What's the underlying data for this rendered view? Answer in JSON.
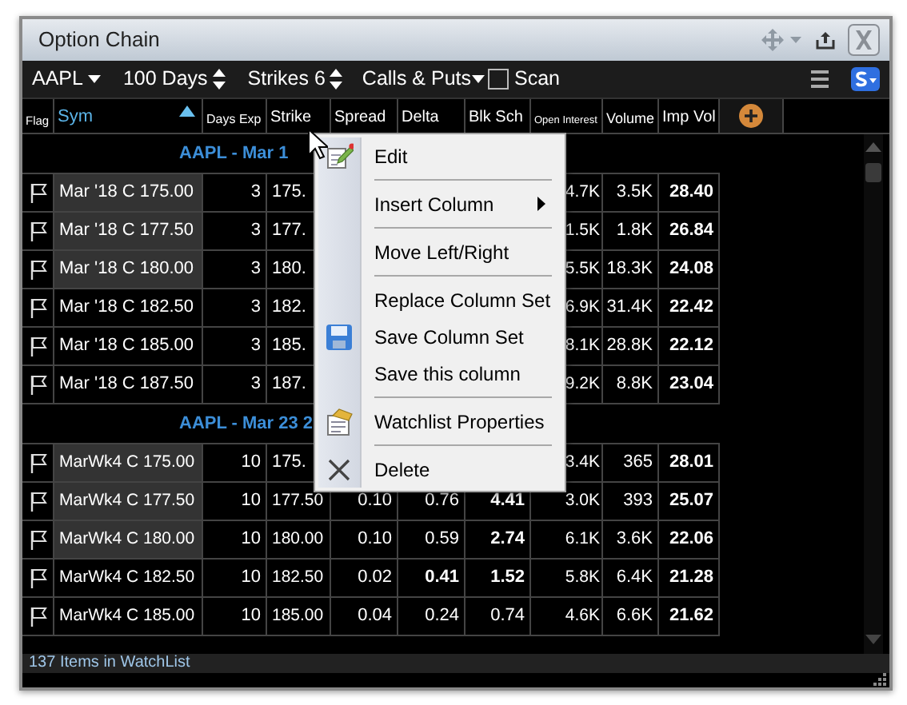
{
  "window": {
    "title": "Option Chain"
  },
  "toolbar": {
    "symbol": "AAPL",
    "days": "100 Days",
    "strikes": "Strikes 6",
    "option_type": "Calls & Puts",
    "scan": {
      "label": "Scan",
      "checked": false
    }
  },
  "columns": [
    {
      "label": "Flag",
      "sorted": false
    },
    {
      "label": "Sym",
      "sorted": true
    },
    {
      "label": "Days Exp",
      "sorted": false
    },
    {
      "label": "Strike",
      "sorted": false
    },
    {
      "label": "Spread",
      "sorted": false
    },
    {
      "label": "Delta",
      "sorted": false
    },
    {
      "label": "Blk Sch",
      "sorted": false
    },
    {
      "label": "Open Interest",
      "sorted": false
    },
    {
      "label": "Volume",
      "sorted": false
    },
    {
      "label": "Imp Vol",
      "sorted": false
    }
  ],
  "groups": [
    {
      "title": "AAPL - Mar 1",
      "rows": [
        {
          "highlighted": true,
          "cells": [
            {
              "text": "Mar '18 C 175.00",
              "bold": false
            },
            {
              "text": "3",
              "bold": false
            },
            {
              "text": "175.",
              "bold": false
            },
            null,
            null,
            null,
            {
              "text": "4.7K",
              "bold": false
            },
            {
              "text": "3.5K",
              "bold": false
            },
            {
              "text": "28.40",
              "bold": true
            }
          ]
        },
        {
          "highlighted": true,
          "cells": [
            {
              "text": "Mar '18 C 177.50",
              "bold": false
            },
            {
              "text": "3",
              "bold": false
            },
            {
              "text": "177.",
              "bold": false
            },
            null,
            null,
            null,
            {
              "text": "1.5K",
              "bold": false
            },
            {
              "text": "1.8K",
              "bold": false
            },
            {
              "text": "26.84",
              "bold": true
            }
          ]
        },
        {
          "highlighted": true,
          "cells": [
            {
              "text": "Mar '18 C 180.00",
              "bold": false
            },
            {
              "text": "3",
              "bold": false
            },
            {
              "text": "180.",
              "bold": false
            },
            null,
            null,
            null,
            {
              "text": "5.5K",
              "bold": false
            },
            {
              "text": "18.3K",
              "bold": false
            },
            {
              "text": "24.08",
              "bold": true
            }
          ]
        },
        {
          "highlighted": false,
          "cells": [
            {
              "text": "Mar '18 C 182.50",
              "bold": false
            },
            {
              "text": "3",
              "bold": false
            },
            {
              "text": "182.",
              "bold": false
            },
            null,
            null,
            null,
            {
              "text": "6.9K",
              "bold": false
            },
            {
              "text": "31.4K",
              "bold": false
            },
            {
              "text": "22.42",
              "bold": true
            }
          ]
        },
        {
          "highlighted": false,
          "cells": [
            {
              "text": "Mar '18 C 185.00",
              "bold": false
            },
            {
              "text": "3",
              "bold": false
            },
            {
              "text": "185.",
              "bold": false
            },
            null,
            null,
            null,
            {
              "text": "8.1K",
              "bold": false
            },
            {
              "text": "28.8K",
              "bold": false
            },
            {
              "text": "22.12",
              "bold": true
            }
          ]
        },
        {
          "highlighted": false,
          "cells": [
            {
              "text": "Mar '18 C 187.50",
              "bold": false
            },
            {
              "text": "3",
              "bold": false
            },
            {
              "text": "187.",
              "bold": false
            },
            null,
            null,
            null,
            {
              "text": "9.2K",
              "bold": false
            },
            {
              "text": "8.8K",
              "bold": false
            },
            {
              "text": "23.04",
              "bold": true
            }
          ]
        }
      ]
    },
    {
      "title": "AAPL - Mar 23 2",
      "rows": [
        {
          "highlighted": true,
          "cells": [
            {
              "text": "MarWk4 C 175.00",
              "bold": false
            },
            {
              "text": "10",
              "bold": false
            },
            {
              "text": "175.",
              "bold": false
            },
            null,
            null,
            null,
            {
              "text": "3.4K",
              "bold": false
            },
            {
              "text": "365",
              "bold": false
            },
            {
              "text": "28.01",
              "bold": true
            }
          ]
        },
        {
          "highlighted": true,
          "cells": [
            {
              "text": "MarWk4 C 177.50",
              "bold": false
            },
            {
              "text": "10",
              "bold": false
            },
            {
              "text": "177.50",
              "bold": false
            },
            {
              "text": "0.10",
              "bold": false
            },
            {
              "text": "0.76",
              "bold": false
            },
            {
              "text": "4.41",
              "bold": true
            },
            {
              "text": "3.0K",
              "bold": false
            },
            {
              "text": "393",
              "bold": false
            },
            {
              "text": "25.07",
              "bold": true
            }
          ]
        },
        {
          "highlighted": true,
          "cells": [
            {
              "text": "MarWk4 C 180.00",
              "bold": false
            },
            {
              "text": "10",
              "bold": false
            },
            {
              "text": "180.00",
              "bold": false
            },
            {
              "text": "0.10",
              "bold": false
            },
            {
              "text": "0.59",
              "bold": false
            },
            {
              "text": "2.74",
              "bold": true
            },
            {
              "text": "6.1K",
              "bold": false
            },
            {
              "text": "3.6K",
              "bold": false
            },
            {
              "text": "22.06",
              "bold": true
            }
          ]
        },
        {
          "highlighted": false,
          "cells": [
            {
              "text": "MarWk4 C 182.50",
              "bold": false
            },
            {
              "text": "10",
              "bold": false
            },
            {
              "text": "182.50",
              "bold": false
            },
            {
              "text": "0.02",
              "bold": false
            },
            {
              "text": "0.41",
              "bold": true
            },
            {
              "text": "1.52",
              "bold": true
            },
            {
              "text": "5.8K",
              "bold": false
            },
            {
              "text": "6.4K",
              "bold": false
            },
            {
              "text": "21.28",
              "bold": true
            }
          ]
        },
        {
          "highlighted": false,
          "cells": [
            {
              "text": "MarWk4 C 185.00",
              "bold": false
            },
            {
              "text": "10",
              "bold": false
            },
            {
              "text": "185.00",
              "bold": false
            },
            {
              "text": "0.04",
              "bold": false
            },
            {
              "text": "0.24",
              "bold": false
            },
            {
              "text": "0.74",
              "bold": false
            },
            {
              "text": "4.6K",
              "bold": false
            },
            {
              "text": "6.6K",
              "bold": false
            },
            {
              "text": "21.62",
              "bold": true
            }
          ]
        }
      ]
    }
  ],
  "status_bar": "137 Items in WatchList",
  "context_menu": [
    {
      "kind": "edit",
      "label": "Edit",
      "submenu": false
    },
    {
      "kind": "separator"
    },
    {
      "kind": "item",
      "label": "Insert Column",
      "submenu": true
    },
    {
      "kind": "separator"
    },
    {
      "kind": "item",
      "label": "Move Left/Right",
      "submenu": false
    },
    {
      "kind": "separator"
    },
    {
      "kind": "item",
      "label": "Replace Column Set",
      "submenu": false
    },
    {
      "kind": "save",
      "label": "Save Column Set",
      "submenu": false
    },
    {
      "kind": "item",
      "label": "Save this column",
      "submenu": false
    },
    {
      "kind": "separator"
    },
    {
      "kind": "properties",
      "label": "Watchlist Properties",
      "submenu": false
    },
    {
      "kind": "separator"
    },
    {
      "kind": "delete",
      "label": "Delete",
      "submenu": false
    }
  ]
}
